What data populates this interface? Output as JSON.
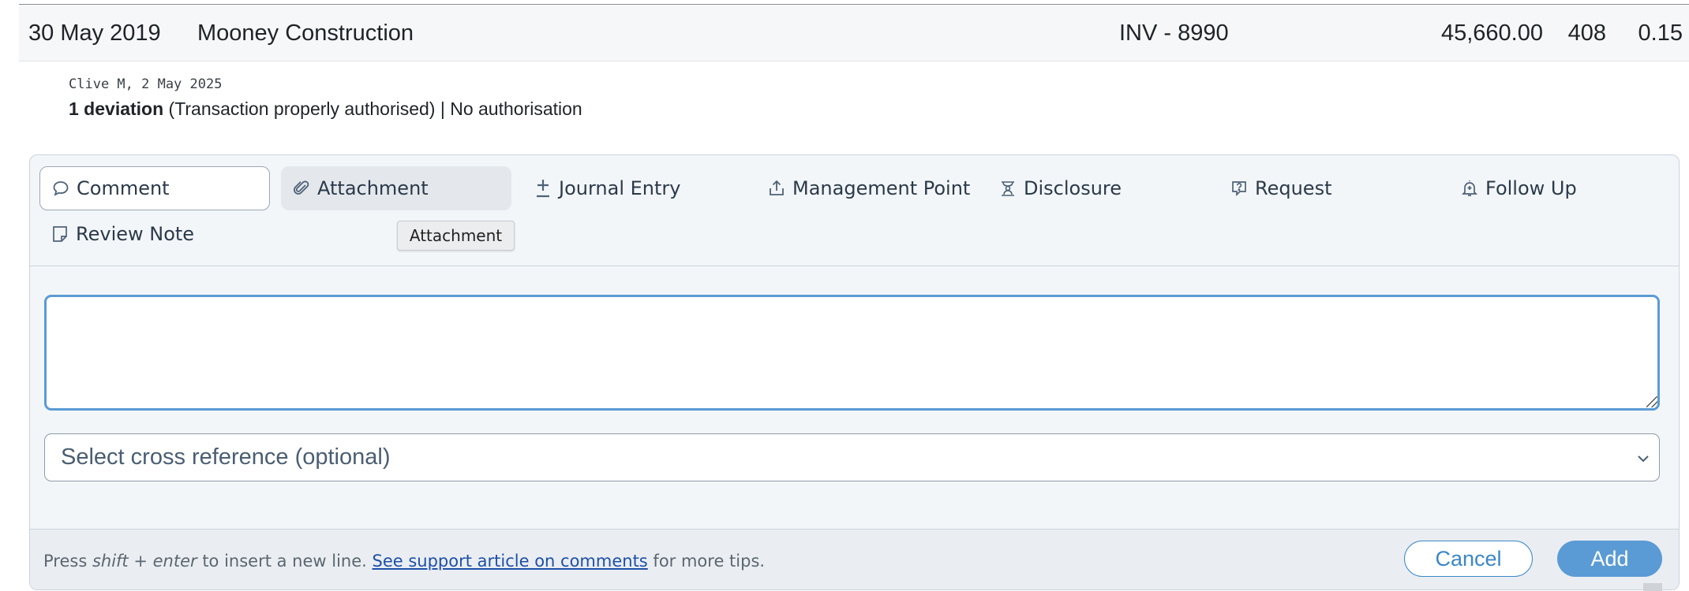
{
  "transaction_row": {
    "date": "30 May 2019",
    "name": "Mooney Construction",
    "invoice": "INV - 8990",
    "amount": "45,660.00",
    "quantity": "408",
    "rate": "0.15"
  },
  "note": {
    "author_line": "Clive M, 2 May 2025",
    "deviation_count": "1 deviation",
    "deviation_detail": " (Transaction properly authorised) | No authorisation"
  },
  "tabs": [
    {
      "label": "Comment",
      "icon": "comment-icon",
      "state": "active"
    },
    {
      "label": "Attachment",
      "icon": "paperclip-icon",
      "state": "hover"
    },
    {
      "label": "Journal Entry",
      "icon": "plus-icon"
    },
    {
      "label": "Management Point",
      "icon": "upload-icon"
    },
    {
      "label": "Disclosure",
      "icon": "disclosure-icon"
    },
    {
      "label": "Request",
      "icon": "question-icon"
    },
    {
      "label": "Follow Up",
      "icon": "bell-icon"
    },
    {
      "label": "Review Note",
      "icon": "note-icon"
    }
  ],
  "tooltip": "Attachment",
  "comment_input": {
    "value": "",
    "placeholder": ""
  },
  "cross_reference": {
    "placeholder": "Select cross reference (optional)"
  },
  "footer": {
    "tip_prefix": "Press ",
    "tip_keys": "shift + enter",
    "tip_middle": " to insert a new line. ",
    "tip_link": "See support article on comments",
    "tip_suffix": " for more tips.",
    "cancel_label": "Cancel",
    "add_label": "Add"
  },
  "colors": {
    "accent": "#5a9bd5",
    "panel_bg": "#f3f6f9",
    "link": "#1e4fa8"
  }
}
